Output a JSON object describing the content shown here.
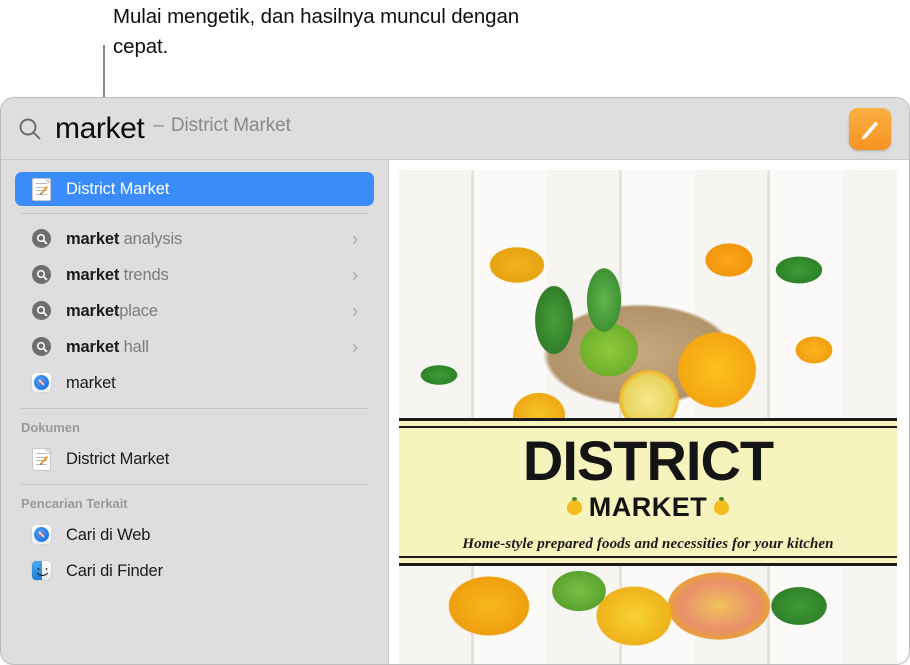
{
  "annotation": {
    "text": "Mulai mengetik, dan hasilnya muncul dengan cepat."
  },
  "search": {
    "icon": "search-icon",
    "query": "market",
    "dash": "–",
    "completion": "District Market",
    "app_badge_icon": "pages-app-icon",
    "accent_color": "#f5a020"
  },
  "results": {
    "top_hit": {
      "icon": "pages-document-icon",
      "label": "District Market",
      "selected": true,
      "highlight_color": "#3a8cfa"
    },
    "suggestions": [
      {
        "icon": "magnifier-circle-icon",
        "match": "market",
        "rest": " analysis",
        "chevron": "›"
      },
      {
        "icon": "magnifier-circle-icon",
        "match": "market",
        "rest": " trends",
        "chevron": "›"
      },
      {
        "icon": "magnifier-circle-icon",
        "match": "market",
        "rest": "place",
        "chevron": "›"
      },
      {
        "icon": "magnifier-circle-icon",
        "match": "market",
        "rest": " hall",
        "chevron": "›"
      }
    ],
    "web_suggestion": {
      "icon": "safari-icon",
      "label": "market"
    },
    "sections": [
      {
        "header": "Dokumen",
        "items": [
          {
            "icon": "pages-document-icon",
            "label": "District Market"
          }
        ]
      },
      {
        "header": "Pencarian Terkait",
        "items": [
          {
            "icon": "safari-icon",
            "label": "Cari di Web"
          },
          {
            "icon": "finder-icon",
            "label": "Cari di Finder"
          }
        ]
      }
    ]
  },
  "preview": {
    "name": "district-market-document-preview",
    "banner": {
      "title": "DISTRICT",
      "subtitle": "MARKET",
      "tagline": "Home-style prepared foods and necessities for your kitchen",
      "background_color": "#f7f3bd",
      "rule_color": "#1c1c1c"
    },
    "photo_description": "citrus-fruit-basket-photo"
  }
}
